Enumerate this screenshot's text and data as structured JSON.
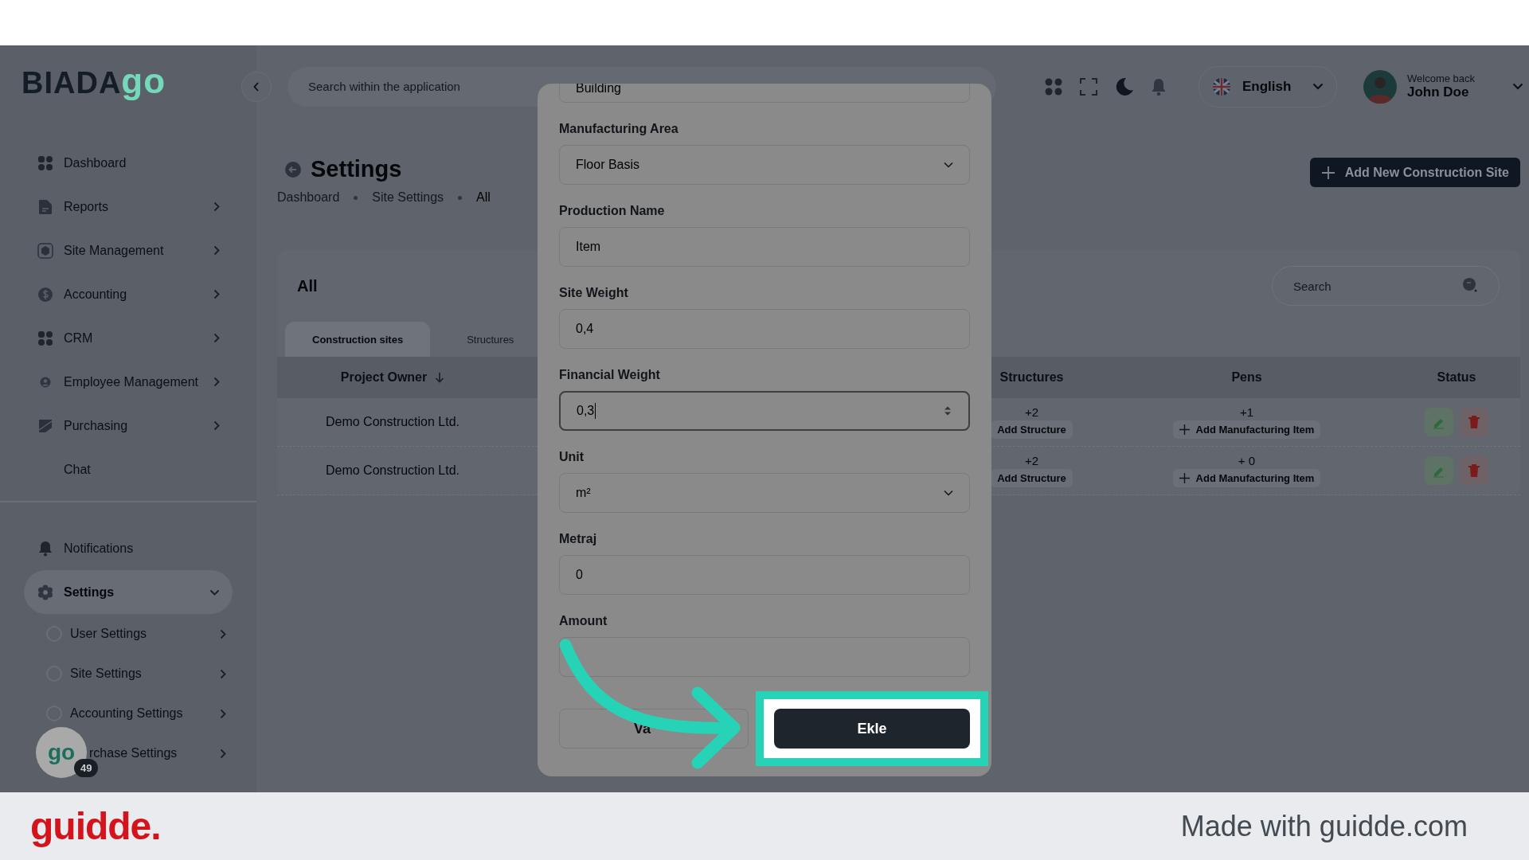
{
  "logo": {
    "text": "BIADA",
    "accent": "go"
  },
  "sidebar": {
    "items": [
      {
        "label": "Dashboard",
        "has_submenu": false
      },
      {
        "label": "Reports",
        "has_submenu": true
      },
      {
        "label": "Site Management",
        "has_submenu": true
      },
      {
        "label": "Accounting",
        "has_submenu": true
      },
      {
        "label": "CRM",
        "has_submenu": true
      },
      {
        "label": "Employee Management",
        "has_submenu": true
      },
      {
        "label": "Purchasing",
        "has_submenu": true
      },
      {
        "label": "Chat",
        "has_submenu": false
      }
    ],
    "bottom_items": [
      {
        "label": "Notifications",
        "selected": false
      },
      {
        "label": "Settings",
        "selected": true,
        "expanded": true,
        "children": [
          {
            "label": "User Settings"
          },
          {
            "label": "Site Settings"
          },
          {
            "label": "Accounting Settings"
          },
          {
            "label": "rchase Settings"
          }
        ]
      }
    ]
  },
  "chat_widget": {
    "logo": "go",
    "count": "49"
  },
  "header": {
    "search_placeholder": "Search within the application",
    "language": "English",
    "greeting": "Welcome back",
    "user_name": "John Doe"
  },
  "page": {
    "title": "Settings",
    "breadcrumbs": [
      {
        "label": "Dashboard",
        "current": false
      },
      {
        "label": "Site Settings",
        "current": false
      },
      {
        "label": "All",
        "current": true
      }
    ],
    "primary_button": "Add New Construction Site"
  },
  "card": {
    "title": "All",
    "search_placeholder": "Search",
    "tabs": [
      {
        "label": "Construction sites",
        "selected": true
      },
      {
        "label": "Structures",
        "selected": false
      }
    ],
    "columns": [
      {
        "label": "Project Owner",
        "sorted": true
      },
      {
        "label": "Structures",
        "sorted": false
      },
      {
        "label": "Pens",
        "sorted": false
      },
      {
        "label": "Status",
        "sorted": false
      }
    ],
    "rows": [
      {
        "project_owner": "Demo Construction Ltd.",
        "structures_count": "+2",
        "structures_action": "Add Structure",
        "pens_count": "+1",
        "pens_action": "Add Manufacturing Item"
      },
      {
        "project_owner": "Demo Construction Ltd.",
        "structures_count": "+2",
        "structures_action": "Add Structure",
        "pens_count": "+ 0",
        "pens_action": "Add Manufacturing Item"
      }
    ]
  },
  "modal": {
    "fields": [
      {
        "kind": "text",
        "value": "Building",
        "focused": false
      },
      {
        "kind": "select",
        "label": "Manufacturing Area",
        "value": "Floor Basis",
        "focused": false
      },
      {
        "kind": "text",
        "label": "Production Name",
        "value": "Item",
        "focused": false
      },
      {
        "kind": "text",
        "label": "Site Weight",
        "value": "0,4",
        "focused": false
      },
      {
        "kind": "number",
        "label": "Financial Weight",
        "value": "0,3",
        "focused": true
      },
      {
        "kind": "select",
        "label": "Unit",
        "value": "m²",
        "focused": false
      },
      {
        "kind": "text",
        "label": "Metraj",
        "value": "0",
        "focused": false
      },
      {
        "kind": "text",
        "label": "Amount",
        "focused": false
      }
    ],
    "buttons": [
      {
        "label": "Va",
        "kind": "secondary",
        "highlighted": false
      },
      {
        "label": "Ekle",
        "kind": "primary",
        "highlighted": true
      }
    ]
  },
  "footer": {
    "brand": "guidde.",
    "credit": "Made with guidde.com"
  }
}
